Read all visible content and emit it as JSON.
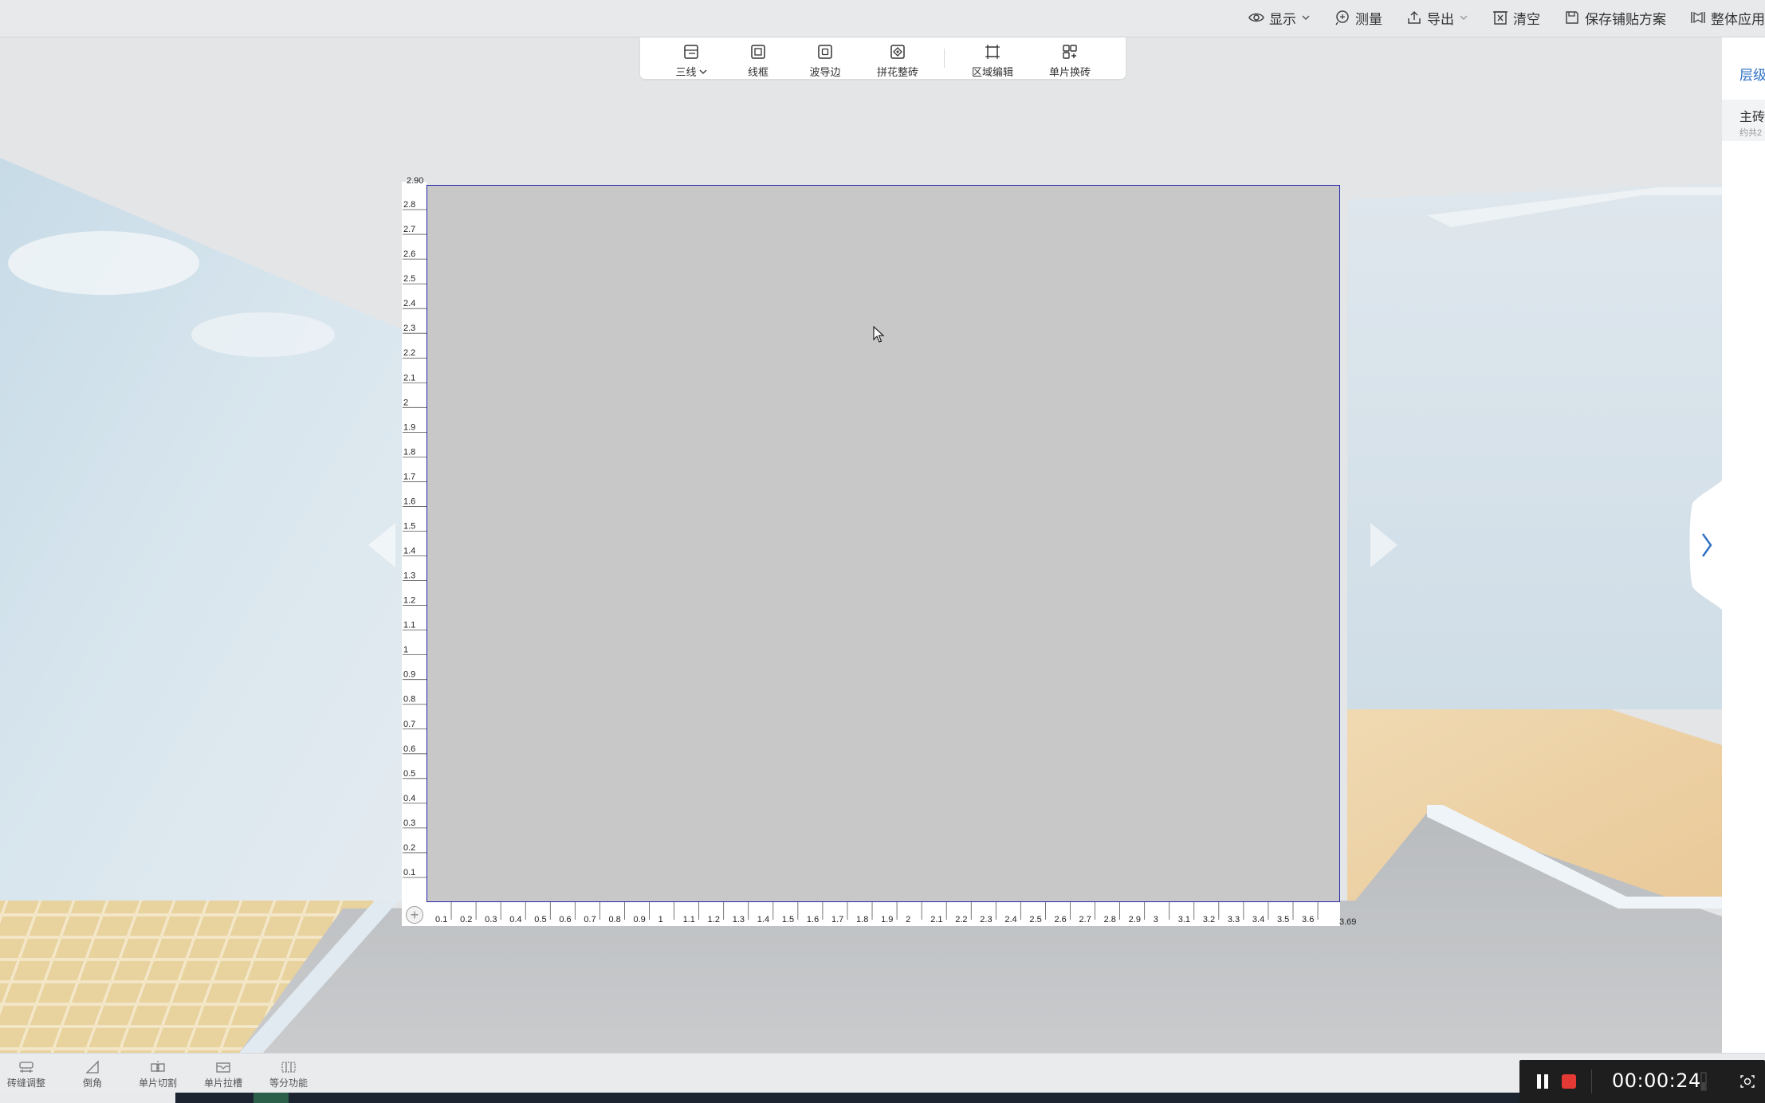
{
  "top_actions": [
    {
      "label": "显示",
      "icon": "eye-icon",
      "has_caret": true
    },
    {
      "label": "测量",
      "icon": "measure-icon",
      "has_caret": false
    },
    {
      "label": "导出",
      "icon": "export-icon",
      "has_caret": true
    },
    {
      "label": "清空",
      "icon": "clear-icon",
      "has_caret": false
    },
    {
      "label": "保存铺贴方案",
      "icon": "save-icon",
      "has_caret": false
    },
    {
      "label": "整体应用",
      "icon": "apply-all-icon",
      "has_caret": false
    }
  ],
  "toolbar": {
    "three_line": "三线",
    "wireframe": "线框",
    "wave_edge": "波导边",
    "parquet_tile": "拼花整砖",
    "region_edit": "区域编辑",
    "single_replace": "单片换砖"
  },
  "canvas": {
    "width_m": 3.69,
    "height_m": 2.9,
    "top_label": "2.90",
    "right_label": "3.69",
    "border_color": "#2424a8",
    "fill_color": "#c8c8c8"
  },
  "side_panel": {
    "tab_label": "层级",
    "item_title": "主砖",
    "item_sub": "约共2"
  },
  "bottom_tools": {
    "gap_adjust": "砖缝调整",
    "chamfer": "倒角",
    "single_cut": "单片切割",
    "single_groove": "单片拉槽",
    "equal_divide": "等分功能"
  },
  "recorder": {
    "time": "00:00:24",
    "stop_color": "#e53935"
  }
}
